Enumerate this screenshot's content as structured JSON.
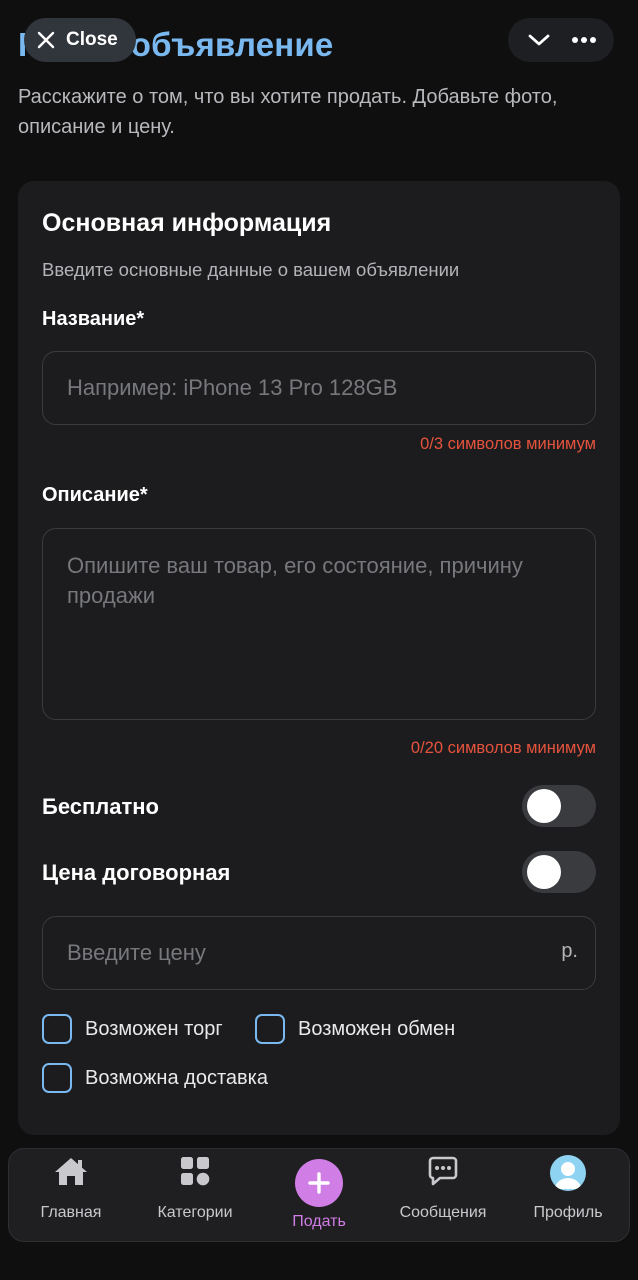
{
  "header": {
    "title": "Новое объявление",
    "close_label": "Close",
    "subtitle": "Расскажите о том, что вы хотите продать. Добавьте фото, описание и цену."
  },
  "form": {
    "section_title": "Основная информация",
    "section_desc": "Введите основные данные о вашем объявлении",
    "name_label": "Название*",
    "name_placeholder": "Например: iPhone 13 Pro 128GB",
    "name_value": "",
    "name_counter": "0/3 символов минимум",
    "desc_label": "Описание*",
    "desc_placeholder": "Опишите ваш товар, его состояние, причину продажи",
    "desc_value": "",
    "desc_counter": "0/20 символов минимум",
    "free_label": "Бесплатно",
    "free_on": false,
    "negotiable_label": "Цена договорная",
    "negotiable_on": false,
    "price_placeholder": "Введите цену",
    "price_value": "",
    "price_suffix": "р.",
    "bargain_label": "Возможен торг",
    "bargain_checked": false,
    "exchange_label": "Возможен обмен",
    "exchange_checked": false,
    "delivery_label": "Возможна доставка",
    "delivery_checked": false
  },
  "tabbar": {
    "home": "Главная",
    "categories": "Категории",
    "post": "Подать",
    "messages": "Сообщения",
    "profile": "Профиль"
  },
  "colors": {
    "accent_blue": "#7ab8f0",
    "accent_purple": "#d07de6",
    "error_red": "#e5533d",
    "card_bg": "#1c1c1e"
  },
  "icons": {
    "close": "close-icon",
    "collapse": "chevron-down-icon",
    "more": "more-dots-icon",
    "home": "home-icon",
    "categories": "grid-icon",
    "post": "plus-icon",
    "messages": "chat-bubble-icon",
    "profile": "avatar-icon"
  }
}
